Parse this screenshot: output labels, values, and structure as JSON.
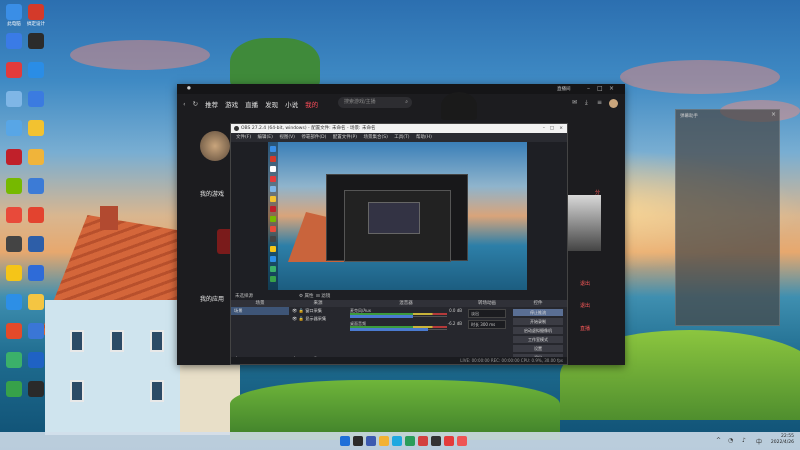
{
  "desktop": {
    "icons": [
      {
        "name": "此电脑",
        "color": "#3a8ee6"
      },
      {
        "name": "搞定设计",
        "color": "#d43a2a"
      },
      {
        "name": "",
        "color": "#3a7be6"
      },
      {
        "name": "",
        "color": "#2b2b2b"
      },
      {
        "name": "",
        "color": "#e33b3b"
      },
      {
        "name": "",
        "color": "#2a8de6"
      },
      {
        "name": "",
        "color": "#7fb6e6"
      },
      {
        "name": "",
        "color": "#3b7be0"
      },
      {
        "name": "",
        "color": "#58a6e6"
      },
      {
        "name": "",
        "color": "#f2c230"
      },
      {
        "name": "",
        "color": "#c0202a"
      },
      {
        "name": "",
        "color": "#f0b43a"
      },
      {
        "name": "",
        "color": "#76b900"
      },
      {
        "name": "",
        "color": "#3c7bd6"
      },
      {
        "name": "",
        "color": "#e84a3a"
      },
      {
        "name": "",
        "color": "#e3432f"
      },
      {
        "name": "",
        "color": "#444"
      },
      {
        "name": "",
        "color": "#2d5ea8"
      },
      {
        "name": "",
        "color": "#f5c518"
      },
      {
        "name": "",
        "color": "#2e6bd8"
      },
      {
        "name": "",
        "color": "#2d8fe6"
      },
      {
        "name": "",
        "color": "#f4c542"
      },
      {
        "name": "",
        "color": "#e44a2a"
      },
      {
        "name": "",
        "color": "#3a76d6"
      },
      {
        "name": "",
        "color": "#3bb06a"
      },
      {
        "name": "",
        "color": "#1f62c4"
      },
      {
        "name": "",
        "color": "#37a14a"
      },
      {
        "name": "",
        "color": "#2a2a2a"
      }
    ]
  },
  "app": {
    "nav": [
      "推荐",
      "游戏",
      "直播",
      "发现",
      "小说",
      "我的"
    ],
    "search_placeholder": "搜索游戏/主播",
    "top_right": "直播间",
    "section_games": "我的游戏",
    "section_apps": "我的应用",
    "red_label": "分",
    "red_side_a": "退出",
    "red_side_b": "退出",
    "red_side_c": "直播"
  },
  "obs": {
    "title": "OBS 27.2.4 (64-bit, windows) - 配置文件: 未命名 - 场景: 未命名",
    "menu": [
      "文件(F)",
      "编辑(E)",
      "视图(V)",
      "停靠部件(D)",
      "配置文件(P)",
      "场景集合(S)",
      "工具(T)",
      "帮助(H)"
    ],
    "scene_source_label": "未选择源",
    "properties_label": "属性",
    "filters_label": "滤镜",
    "docks": {
      "scenes": {
        "title": "场景",
        "items": [
          "场景"
        ]
      },
      "sources": {
        "title": "来源",
        "items": [
          "窗口采集",
          "显示器采集"
        ]
      },
      "mixer": {
        "title": "混音器",
        "rows": [
          {
            "label": "麦克风/Aux",
            "db": "0.0 dB",
            "meter": 0.65
          },
          {
            "label": "桌面音频",
            "db": "-6.2 dB",
            "meter": 0.8
          }
        ]
      },
      "transitions": {
        "title": "转场动画",
        "mode": "淡出",
        "duration_label": "时长",
        "duration": "300 ms"
      },
      "controls": {
        "title": "控件",
        "buttons": [
          "停止推流",
          "开始录制",
          "启动虚拟摄像机",
          "工作室模式",
          "设置",
          "退出"
        ]
      }
    },
    "status": "LIVE: 00:00:00   REC: 00:00:00   CPU: 0.9%, 30.00 fps"
  },
  "right_panel": {
    "title": "弹幕助手"
  },
  "taskbar": {
    "icons": [
      {
        "name": "",
        "color": "#1e6fd9"
      },
      {
        "name": "",
        "color": "#2b2b2b"
      },
      {
        "name": "",
        "color": "#3b5ab0"
      },
      {
        "name": "",
        "color": "#f2b233"
      },
      {
        "name": "",
        "color": "#1fa8e0"
      },
      {
        "name": "",
        "color": "#2a9d5a"
      },
      {
        "name": "",
        "color": "#d23f3f"
      },
      {
        "name": "",
        "color": "#333"
      },
      {
        "name": "",
        "color": "#e33b3b"
      },
      {
        "name": "",
        "color": "#e55"
      }
    ],
    "time": "22:55",
    "date": "2022/4/26"
  }
}
